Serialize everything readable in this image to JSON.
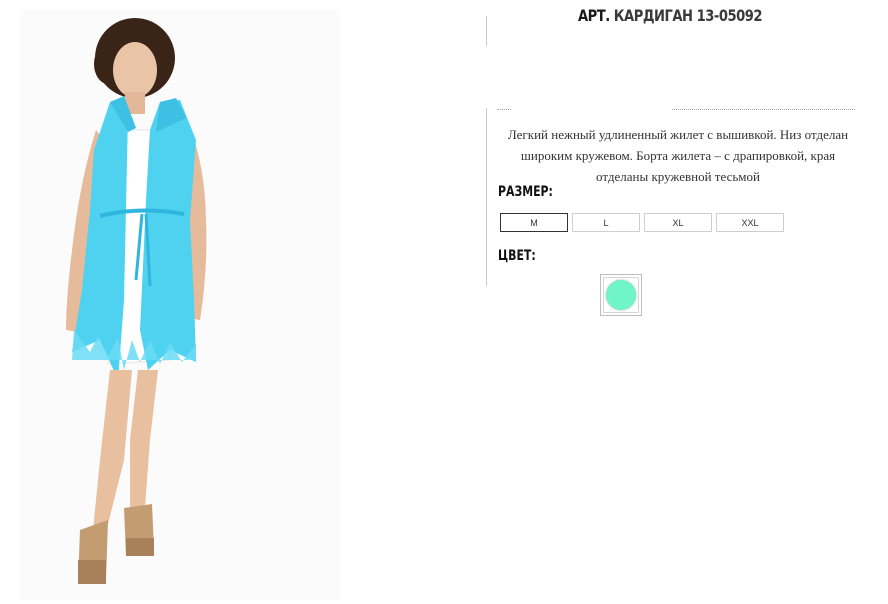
{
  "product": {
    "title_prefix": "АРТ.",
    "title_name": "КАРДИГАН 13-05092",
    "description": "Легкий нежный удлиненный жилет с вышивкой. Низ отделан широким кружевом. Борта жилета – с драпировкой, края отделаны кружевной тесьмой",
    "size_label": "РАЗМЕР:",
    "sizes": [
      {
        "label": "M"
      },
      {
        "label": "L"
      },
      {
        "label": "XL"
      },
      {
        "label": "XXL"
      }
    ],
    "selected_size": "M",
    "color_label": "ЦВЕТ:",
    "colors": [
      {
        "hex": "#6ff5c8",
        "name": "mint-swatch"
      }
    ],
    "dress_color": "#4fd1f0"
  }
}
